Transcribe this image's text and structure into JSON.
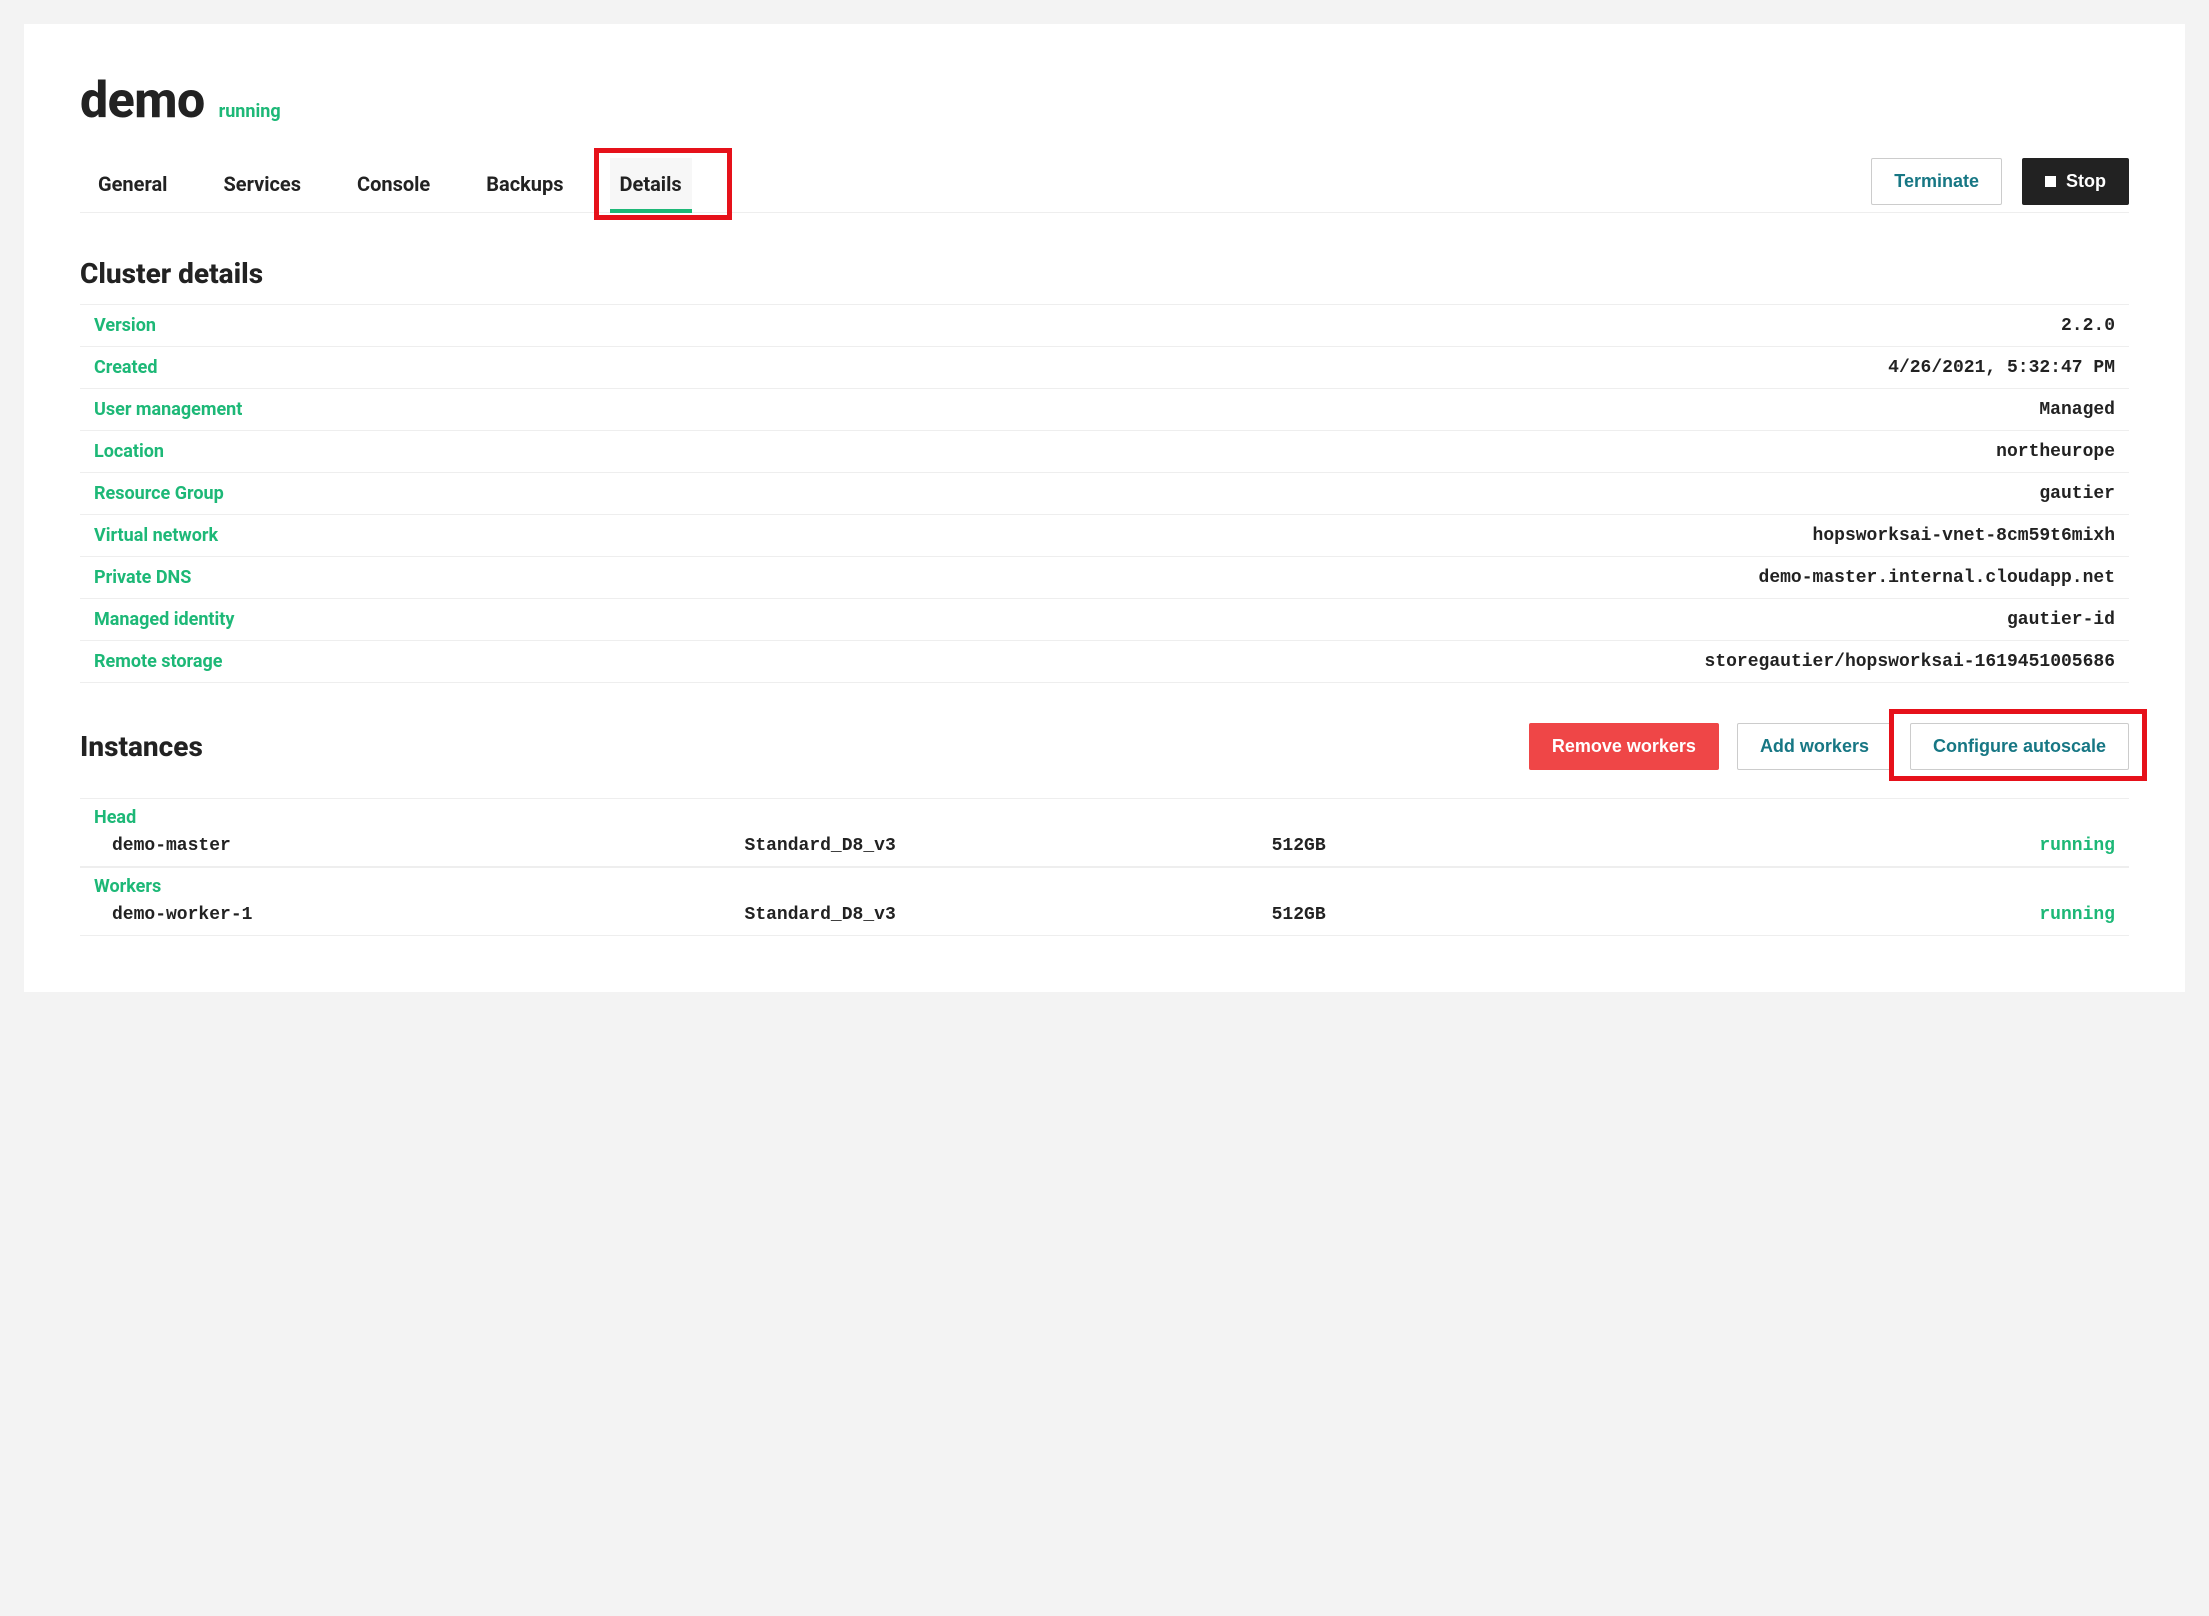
{
  "cluster": {
    "name": "demo",
    "status": "running"
  },
  "tabs": {
    "general": "General",
    "services": "Services",
    "console": "Console",
    "backups": "Backups",
    "details": "Details"
  },
  "actions": {
    "terminate": "Terminate",
    "stop": "Stop"
  },
  "sections": {
    "cluster_details": "Cluster details",
    "instances": "Instances"
  },
  "details": {
    "labels": {
      "version": "Version",
      "created": "Created",
      "user_management": "User management",
      "location": "Location",
      "resource_group": "Resource Group",
      "virtual_network": "Virtual network",
      "private_dns": "Private DNS",
      "managed_identity": "Managed identity",
      "remote_storage": "Remote storage"
    },
    "values": {
      "version": "2.2.0",
      "created": "4/26/2021, 5:32:47 PM",
      "user_management": "Managed",
      "location": "northeurope",
      "resource_group": "gautier",
      "virtual_network": "hopsworksai-vnet-8cm59t6mixh",
      "private_dns": "demo-master.internal.cloudapp.net",
      "managed_identity": "gautier-id",
      "remote_storage": "storegautier/hopsworksai-1619451005686"
    }
  },
  "instance_actions": {
    "remove_workers": "Remove workers",
    "add_workers": "Add workers",
    "configure_autoscale": "Configure autoscale"
  },
  "instances": {
    "head_label": "Head",
    "workers_label": "Workers",
    "head": {
      "name": "demo-master",
      "type": "Standard_D8_v3",
      "disk": "512GB",
      "status": "running"
    },
    "workers": [
      {
        "name": "demo-worker-1",
        "type": "Standard_D8_v3",
        "disk": "512GB",
        "status": "running"
      }
    ]
  }
}
